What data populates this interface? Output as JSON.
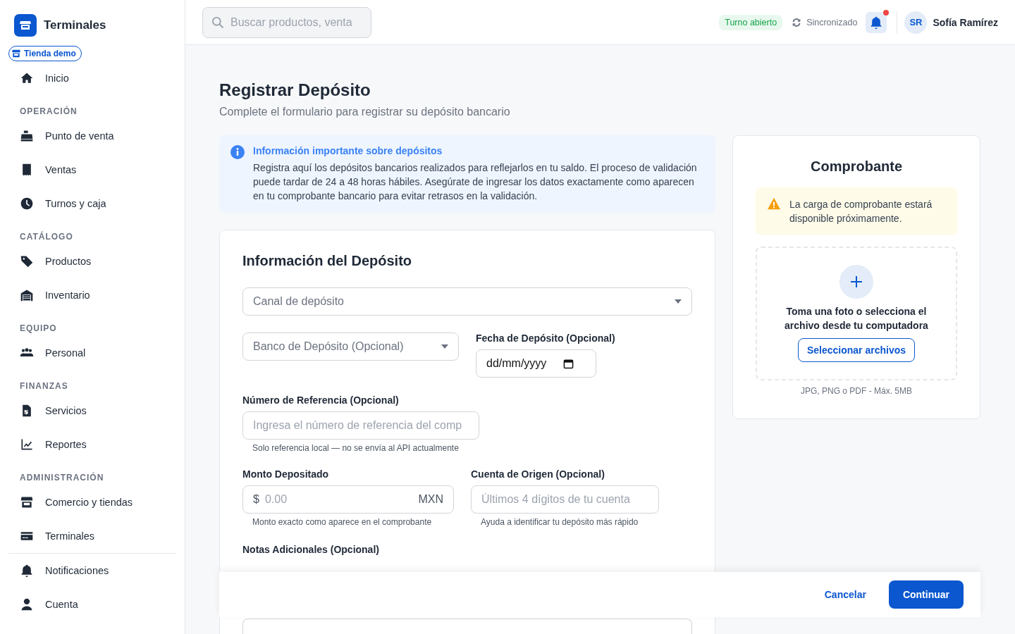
{
  "brand": {
    "name": "Terminales",
    "store_badge": "Tienda demo"
  },
  "sidebar": {
    "sections": [
      {
        "items": [
          {
            "label": "Inicio"
          }
        ]
      },
      {
        "heading": "OPERACIÓN",
        "items": [
          {
            "label": "Punto de venta"
          },
          {
            "label": "Ventas"
          },
          {
            "label": "Turnos y caja"
          }
        ]
      },
      {
        "heading": "CATÁLOGO",
        "items": [
          {
            "label": "Productos"
          },
          {
            "label": "Inventario"
          }
        ]
      },
      {
        "heading": "EQUIPO",
        "items": [
          {
            "label": "Personal"
          }
        ]
      },
      {
        "heading": "FINANZAS",
        "items": [
          {
            "label": "Servicios"
          },
          {
            "label": "Reportes"
          }
        ]
      },
      {
        "heading": "ADMINISTRACIÓN",
        "items": [
          {
            "label": "Comercio y tiendas"
          },
          {
            "label": "Terminales"
          }
        ]
      }
    ],
    "footer_items": [
      {
        "label": "Notificaciones"
      },
      {
        "label": "Cuenta"
      }
    ]
  },
  "topbar": {
    "search": {
      "placeholder": "Buscar productos, venta"
    },
    "shift_badge": "Turno abierto",
    "sync_status": "Sincronizado",
    "notifications_unread": true,
    "user": {
      "initials": "SR",
      "name": "Sofía Ramírez"
    }
  },
  "page": {
    "title": "Registrar Depósito",
    "subtitle": "Complete el formulario para registrar su depósito bancario"
  },
  "info_alert": {
    "title": "Información importante sobre depósitos",
    "text": "Registra aquí los depósitos bancarios realizados para reflejarlos en tu saldo. El proceso de validación puede tardar de 24 a 48 horas hábiles. Asegúrate de ingresar los datos exactamente como aparecen en tu comprobante bancario para evitar retrasos en la validación."
  },
  "form": {
    "title": "Información del Depósito",
    "channel": {
      "placeholder": "Canal de depósito"
    },
    "bank": {
      "placeholder": "Banco de Depósito (Opcional)"
    },
    "date": {
      "label": "Fecha de Depósito (Opcional)",
      "placeholder": "dd/mm/yyyy"
    },
    "reference": {
      "label": "Número de Referencia (Opcional)",
      "placeholder": "Ingresa el número de referencia del comp",
      "help": "Solo referencia local — no se envía al API actualmente"
    },
    "amount": {
      "label": "Monto Depositado",
      "prefix": "$",
      "placeholder": "0.00",
      "suffix": "MXN",
      "help": "Monto exacto como aparece en el comprobante"
    },
    "account": {
      "label": "Cuenta de Origen (Opcional)",
      "placeholder": "Últimos 4 dígitos de tu cuenta",
      "help": "Ayuda a identificar tu depósito más rápido"
    },
    "notes": {
      "label": "Notas Adicionales (Opcional)"
    }
  },
  "receipt": {
    "title": "Comprobante",
    "warning": "La carga de comprobante estará disponible próximamente.",
    "drop_text": "Toma una foto o selecciona el archivo desde tu computadora",
    "button": "Seleccionar archivos",
    "hint": "JPG, PNG o PDF - Máx. 5MB"
  },
  "actions": {
    "cancel": "Cancelar",
    "continue": "Continuar"
  }
}
